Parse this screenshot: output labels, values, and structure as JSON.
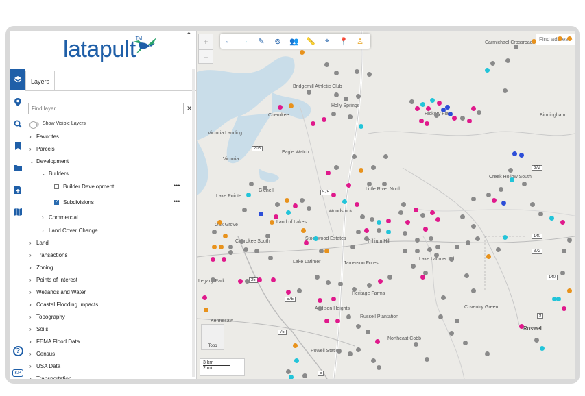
{
  "brand": {
    "name": "latapult",
    "tm": "TM"
  },
  "panel": {
    "tab": "Layers",
    "search_placeholder": "Find layer...",
    "clear": "✕",
    "toggle_label": "Show Visible Layers",
    "tree": [
      {
        "label": "Favorites",
        "caret": "›",
        "indent": 0,
        "type": "group"
      },
      {
        "label": "Parcels",
        "caret": "›",
        "indent": 0,
        "type": "group"
      },
      {
        "label": "Development",
        "caret": "⌄",
        "indent": 0,
        "type": "group"
      },
      {
        "label": "Builders",
        "caret": "⌄",
        "indent": 1,
        "type": "group"
      },
      {
        "label": "Builder Development",
        "indent": 2,
        "type": "layer",
        "checked": false
      },
      {
        "label": "Subdivisions",
        "indent": 2,
        "type": "layer",
        "checked": true
      },
      {
        "label": "Commercial",
        "caret": "›",
        "indent": 1,
        "type": "group"
      },
      {
        "label": "Land Cover Change",
        "caret": "›",
        "indent": 1,
        "type": "group"
      },
      {
        "label": "Land",
        "caret": "›",
        "indent": 0,
        "type": "group"
      },
      {
        "label": "Transactions",
        "caret": "›",
        "indent": 0,
        "type": "group"
      },
      {
        "label": "Zoning",
        "caret": "›",
        "indent": 0,
        "type": "group"
      },
      {
        "label": "Points of Interest",
        "caret": "›",
        "indent": 0,
        "type": "group"
      },
      {
        "label": "Wetlands and Water",
        "caret": "›",
        "indent": 0,
        "type": "group"
      },
      {
        "label": "Coastal Flooding Impacts",
        "caret": "›",
        "indent": 0,
        "type": "group"
      },
      {
        "label": "Topography",
        "caret": "›",
        "indent": 0,
        "type": "group"
      },
      {
        "label": "Soils",
        "caret": "›",
        "indent": 0,
        "type": "group"
      },
      {
        "label": "FEMA Flood Data",
        "caret": "›",
        "indent": 0,
        "type": "group"
      },
      {
        "label": "Census",
        "caret": "›",
        "indent": 0,
        "type": "group"
      },
      {
        "label": "USA Data",
        "caret": "›",
        "indent": 0,
        "type": "group"
      },
      {
        "label": "Transportation",
        "caret": "›",
        "indent": 0,
        "type": "group"
      }
    ],
    "more": "•••"
  },
  "sidebar_icons": [
    "layers-icon",
    "map-pin-icon",
    "search-icon",
    "bookmark-icon",
    "folder-icon",
    "add-file-icon",
    "map-icon"
  ],
  "help": "?",
  "user_initials": "KP",
  "map": {
    "zoom_in": "+",
    "zoom_out": "−",
    "toolbar": [
      "back-arrow-icon",
      "forward-arrow-icon",
      "draw-pen-icon",
      "steering-wheel-icon",
      "people-icon",
      "measure-ruler-icon",
      "crosshair-icon",
      "location-pin-icon",
      "street-view-icon"
    ],
    "address_placeholder": "Find address o",
    "basemap_label": "Topo",
    "scale_km": "3 km",
    "scale_mi": "2 mi",
    "places": [
      "Carmichael Crossroads",
      "Birmingham",
      "Bridgemill Athletic Club",
      "Holly Springs",
      "Cherokee",
      "Hickory Flat",
      "Victoria Landing",
      "Victoria",
      "Eagle Watch",
      "Creek Hollow South",
      "Glenell",
      "Little River North",
      "Lake Pointe",
      "Woodstock",
      "Land of Lakes",
      "Oak Grove",
      "Cherokee South",
      "Stockwood Estates",
      "Trillium Hill",
      "Lake Latimer",
      "Jamerson Forest",
      "Heritage Farms",
      "Addison Heights",
      "Russell Plantation",
      "Coventry Green",
      "Roswell",
      "Northeast Cobb",
      "Powell Station",
      "Kennesaw",
      "Legacy Park",
      "Lake Latimer Rd"
    ],
    "colors": {
      "gray": "#8a8a8a",
      "magenta": "#e0198c",
      "orange": "#e8921c",
      "cyan": "#22c4d9",
      "blue": "#2d4ed8",
      "purple": "#b13ee0"
    }
  }
}
